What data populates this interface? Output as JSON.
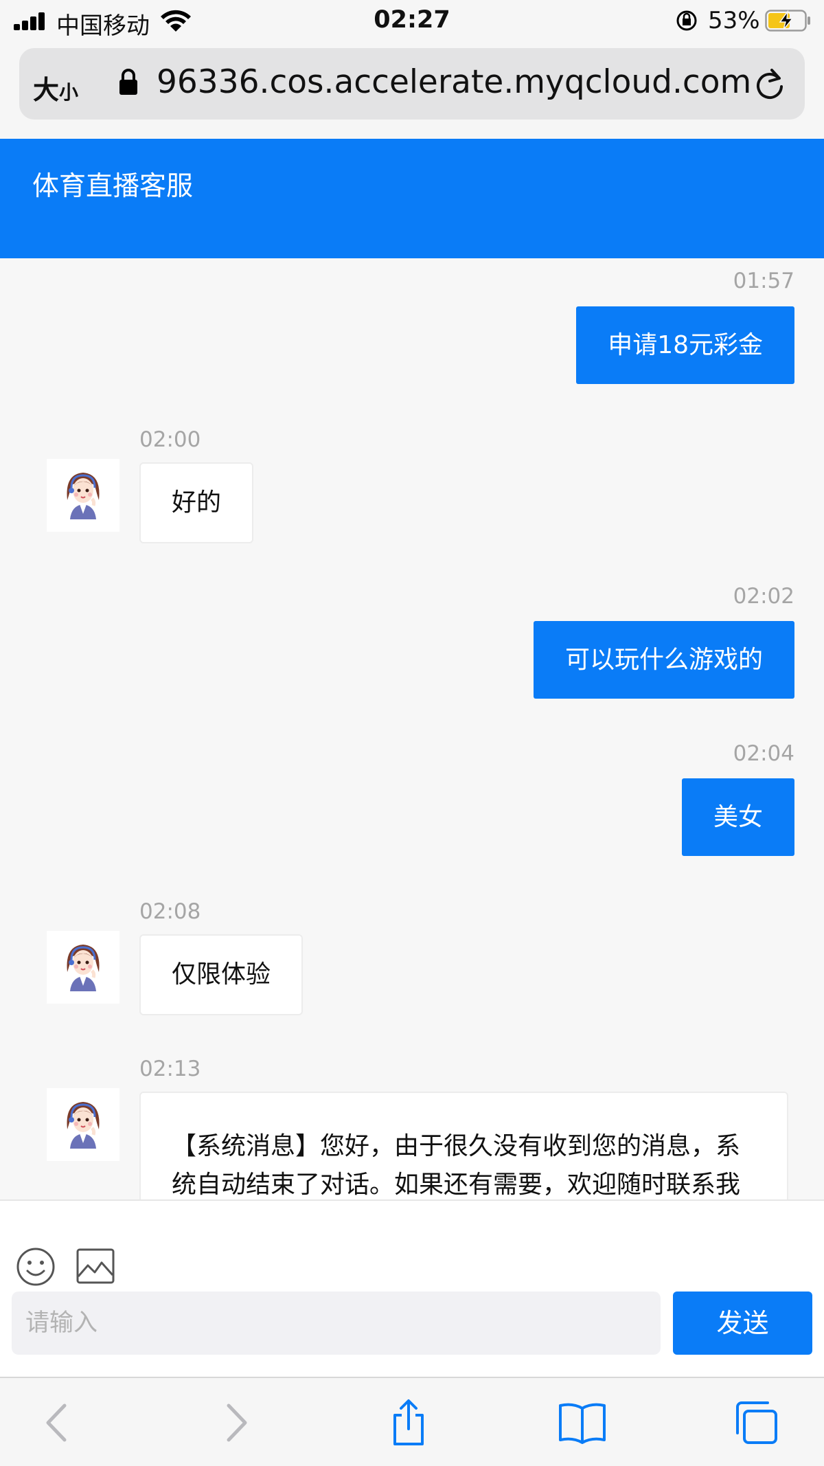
{
  "status_bar": {
    "carrier": "中国移动",
    "time": "02:27",
    "battery_percent": "53%"
  },
  "browser": {
    "text_size_big": "大",
    "text_size_small": "小",
    "url": "96336.cos.accelerate.myqcloud.com"
  },
  "header": {
    "title": "体育直播客服"
  },
  "messages": [
    {
      "side": "out",
      "time": "01:57",
      "text": "申请18元彩金"
    },
    {
      "side": "in",
      "time": "02:00",
      "text": "好的"
    },
    {
      "side": "out",
      "time": "02:02",
      "text": "可以玩什么游戏的"
    },
    {
      "side": "out",
      "time": "02:04",
      "text": "美女"
    },
    {
      "side": "in",
      "time": "02:08",
      "text": "仅限体验"
    },
    {
      "side": "in",
      "time": "02:13",
      "text": "【系统消息】您好，由于很久没有收到您的消息，系统自动结束了对话。如果还有需要，欢迎随时联系我们。"
    }
  ],
  "composer": {
    "placeholder": "请输入",
    "send_label": "发送"
  },
  "icons": {
    "emoji": "smiley-icon",
    "image": "image-icon",
    "back": "chevron-left-icon",
    "forward": "chevron-right-icon",
    "share": "share-icon",
    "bookmarks": "book-icon",
    "tabs": "tabs-icon"
  },
  "colors": {
    "accent": "#0a7cf7"
  }
}
